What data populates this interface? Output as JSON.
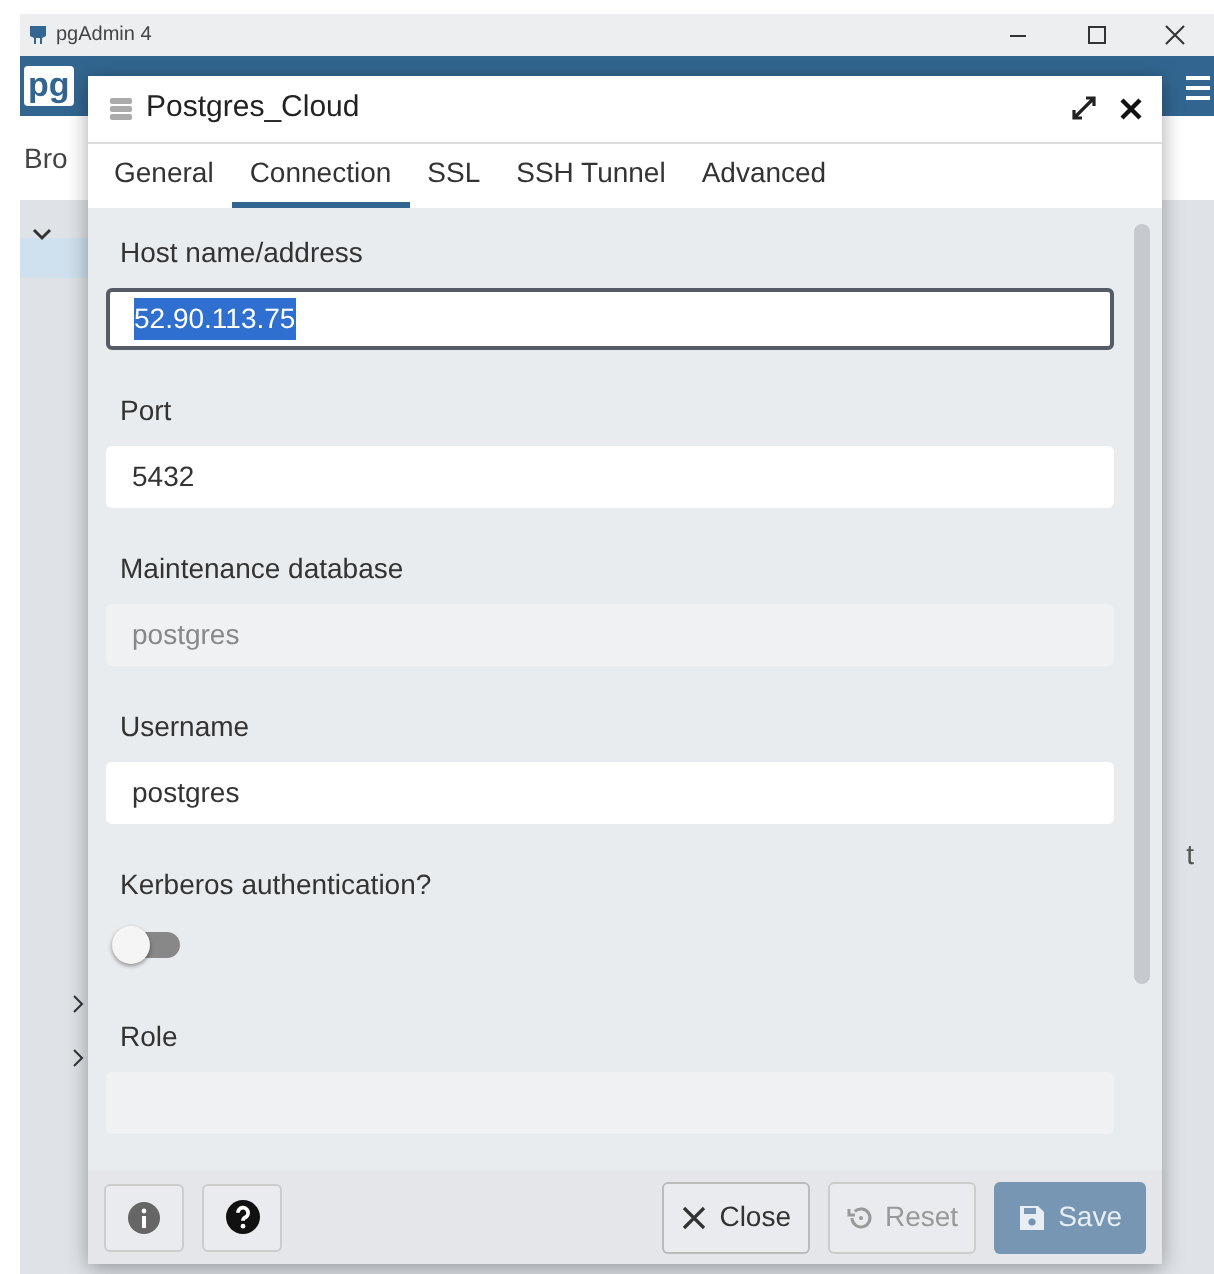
{
  "app": {
    "title": "pgAdmin 4",
    "logo": "pg",
    "browser_tab": "Bro",
    "side_text": "t"
  },
  "dialog": {
    "title": "Postgres_Cloud",
    "tabs": [
      {
        "label": "General",
        "selected": false
      },
      {
        "label": "Connection",
        "selected": true
      },
      {
        "label": "SSL",
        "selected": false
      },
      {
        "label": "SSH Tunnel",
        "selected": false
      },
      {
        "label": "Advanced",
        "selected": false
      }
    ],
    "fields": [
      {
        "kind": "text",
        "label": "Host name/address",
        "value": "52.90.113.75",
        "focused": true,
        "disabled": false
      },
      {
        "kind": "text",
        "label": "Port",
        "value": "5432",
        "focused": false,
        "disabled": false
      },
      {
        "kind": "text",
        "label": "Maintenance database",
        "value": "postgres",
        "focused": false,
        "disabled": true
      },
      {
        "kind": "text",
        "label": "Username",
        "value": "postgres",
        "focused": false,
        "disabled": false
      },
      {
        "kind": "switch",
        "label": "Kerberos authentication?",
        "on": false
      },
      {
        "kind": "text",
        "label": "Role",
        "focused": false,
        "disabled": true
      }
    ],
    "buttons": [
      {
        "kind": "close",
        "label": "Close",
        "disabled": false
      },
      {
        "kind": "reset",
        "label": "Reset",
        "disabled": true
      },
      {
        "kind": "save",
        "label": "Save",
        "disabled": true
      }
    ]
  }
}
